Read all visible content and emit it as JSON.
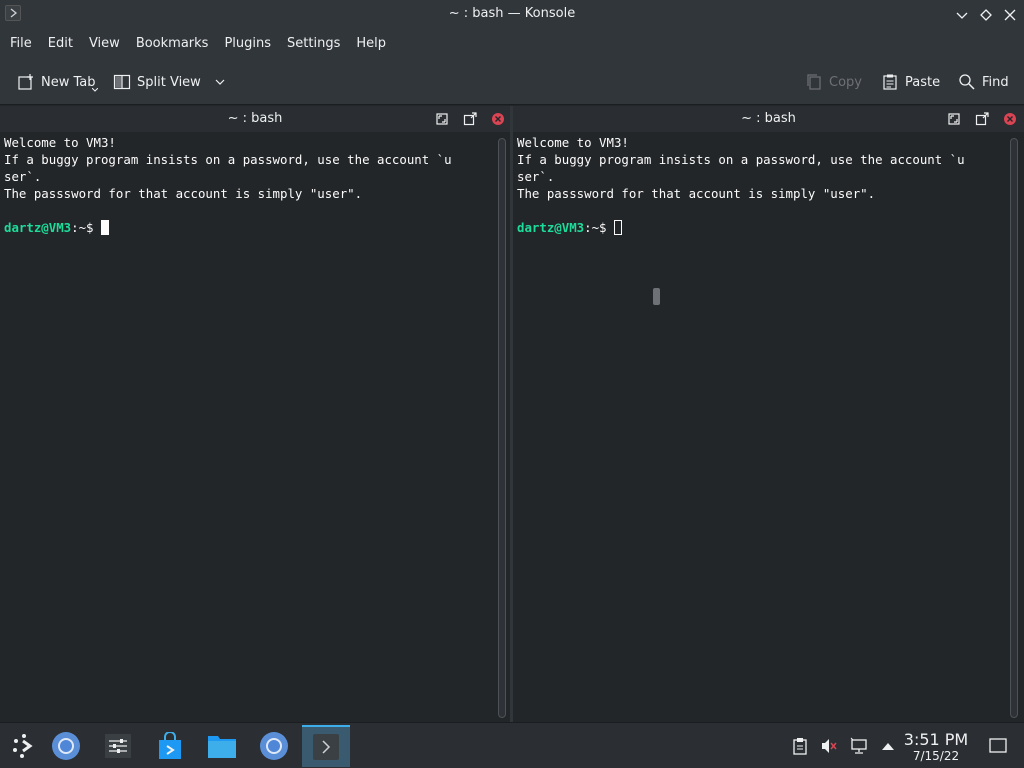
{
  "window": {
    "title": "~ : bash — Konsole"
  },
  "menu": [
    "File",
    "Edit",
    "View",
    "Bookmarks",
    "Plugins",
    "Settings",
    "Help"
  ],
  "toolbar": {
    "new_tab": "New Tab",
    "split_view": "Split View",
    "copy": "Copy",
    "paste": "Paste",
    "find": "Find"
  },
  "panes": [
    {
      "title": "~ : bash",
      "lines": [
        "Welcome to VM3!",
        "If a buggy program insists on a password, use the account `u",
        "ser`.",
        "The passsword for that account is simply \"user\"."
      ],
      "prompt_user": "dartz@VM3",
      "prompt_rest": ":~$ "
    },
    {
      "title": "~ : bash",
      "lines": [
        "Welcome to VM3!",
        "If a buggy program insists on a password, use the account `u",
        "ser`.",
        "The passsword for that account is simply \"user\"."
      ],
      "prompt_user": "dartz@VM3",
      "prompt_rest": ":~$ "
    }
  ],
  "taskbar": {
    "time": "3:51 PM",
    "date": "7/15/22",
    "apps": [
      "app-launcher-icon",
      "chromium-icon",
      "mixer-icon",
      "store-icon",
      "files-icon",
      "chromium-icon",
      "konsole-icon"
    ]
  },
  "colors": {
    "accent": "#3daee9",
    "prompt": "#1cdc9a",
    "close": "#da4453"
  }
}
